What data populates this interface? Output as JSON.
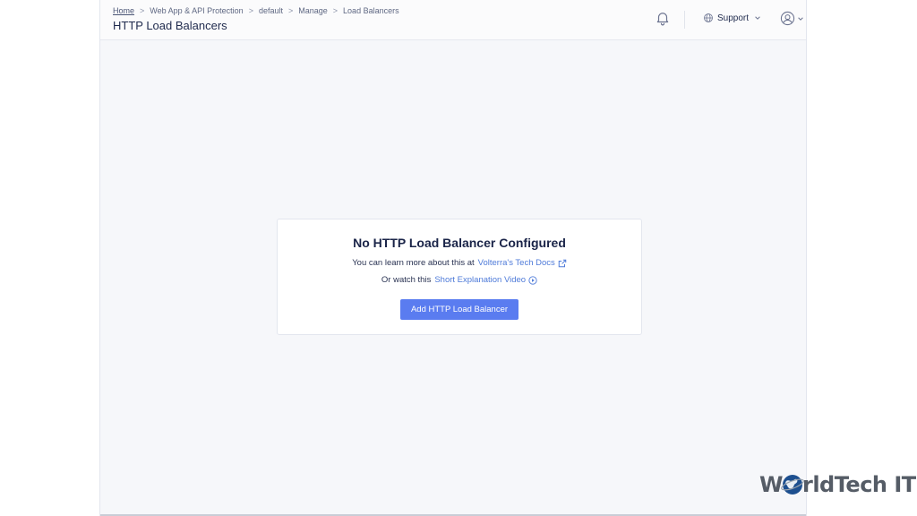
{
  "breadcrumb": {
    "items": [
      "Home",
      "Web App & API Protection",
      "default",
      "Manage",
      "Load Balancers"
    ]
  },
  "header": {
    "title": "HTTP Load Balancers",
    "support_label": "Support",
    "icons": [
      "bell-icon",
      "globe-icon",
      "user-icon",
      "chevron-down-icon"
    ]
  },
  "empty_state": {
    "title": "No HTTP Load Balancer Configured",
    "line1_prefix": "You can learn more about this at",
    "line1_link": "Volterra's Tech Docs",
    "line2_prefix": "Or watch this",
    "line2_link": "Short Explanation Video",
    "button_label": "Add HTTP Load Balancer"
  },
  "watermark": {
    "part1": "W",
    "part2": "rldTech IT"
  },
  "colors": {
    "accent": "#5a7cf0",
    "link": "#4f7bd9",
    "text": "#1f2a4d",
    "background": "#f6f7fa"
  }
}
